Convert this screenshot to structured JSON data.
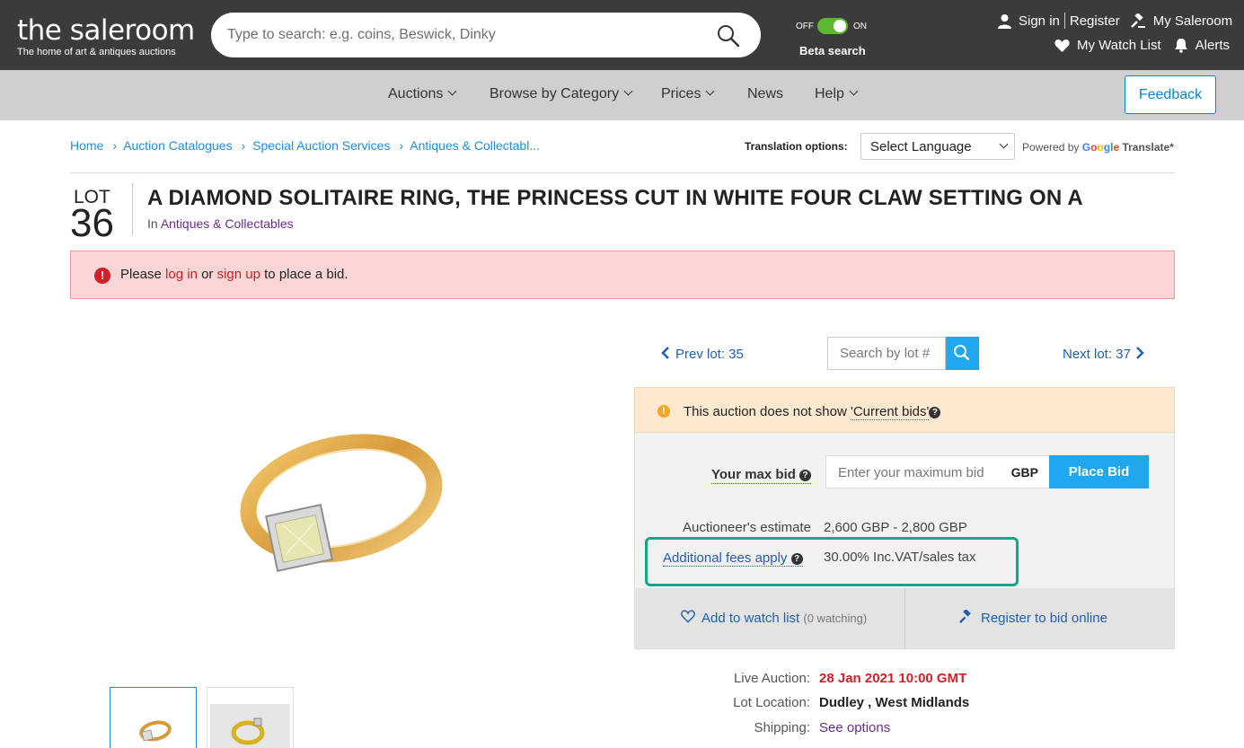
{
  "header": {
    "brand_name": "the saleroom",
    "brand_tagline": "The home of art & antiques auctions",
    "search_placeholder": "Type to search: e.g. coins, Beswick, Dinky",
    "toggle_off": "OFF",
    "toggle_on": "ON",
    "beta_label": "Beta search",
    "sign_in": "Sign in",
    "register": "Register",
    "my_saleroom": "My Saleroom",
    "watch_list": "My Watch List",
    "alerts": "Alerts"
  },
  "nav": {
    "items": [
      "Auctions",
      "Browse by Category",
      "Prices",
      "News",
      "Help"
    ],
    "feedback": "Feedback"
  },
  "breadcrumb": [
    "Home",
    "Auction Catalogues",
    "Special Auction Services",
    "Antiques & Collectabl..."
  ],
  "translation": {
    "label": "Translation options:",
    "select_value": "Select Language",
    "powered_by": "Powered by",
    "google": [
      "G",
      "o",
      "o",
      "g",
      "l",
      "e"
    ],
    "translate": "Translate*"
  },
  "lot": {
    "label": "LOT",
    "number": "36",
    "title": "A DIAMOND SOLITAIRE RING, THE PRINCESS CUT IN WHITE FOUR CLAW SETTING ON A",
    "category_prefix": "In",
    "category": "Antiques & Collectables"
  },
  "alert": {
    "prefix": "Please",
    "login": "log in",
    "or": "or",
    "signup": "sign up",
    "suffix": "to place a bid."
  },
  "lot_nav": {
    "prev": "Prev lot: 35",
    "next": "Next lot: 37",
    "search_placeholder": "Search by lot #"
  },
  "bid": {
    "notice_text": "This auction does not show",
    "notice_link": "'Current bids'",
    "max_bid_label": "Your max bid",
    "max_bid_placeholder": "Enter your maximum bid",
    "currency": "GBP",
    "place_bid": "Place Bid",
    "estimate_label": "Auctioneer's estimate",
    "estimate_value": "2,600 GBP - 2,800 GBP",
    "fees_label": "Additional fees apply",
    "fees_value": "30.00% Inc.VAT/sales tax",
    "watch_label": "Add to watch list",
    "watch_count": "(0 watching)",
    "register_label": "Register to bid online"
  },
  "auction_info": {
    "live_label": "Live Auction:",
    "live_value": "28 Jan 2021 10:00 GMT",
    "location_label": "Lot Location:",
    "location_value": "Dudley , West Midlands",
    "shipping_label": "Shipping:",
    "shipping_value": "See options"
  },
  "colors": {
    "header_bg": "#3b3b3b",
    "nav_bg": "#cfcfcf",
    "accent_blue": "#1fa8f0",
    "link_blue": "#1f5fb5",
    "alert_red": "#d31f27",
    "highlight_teal": "#17a589",
    "purple_link": "#6a2c8a"
  },
  "icons": [
    "search-icon",
    "user-icon",
    "gavel-icon",
    "heart-icon",
    "bell-icon",
    "chevron-down-icon",
    "exclamation-icon",
    "warning-icon",
    "question-icon",
    "chevron-left-icon",
    "chevron-right-icon",
    "gavel-small-icon"
  ]
}
